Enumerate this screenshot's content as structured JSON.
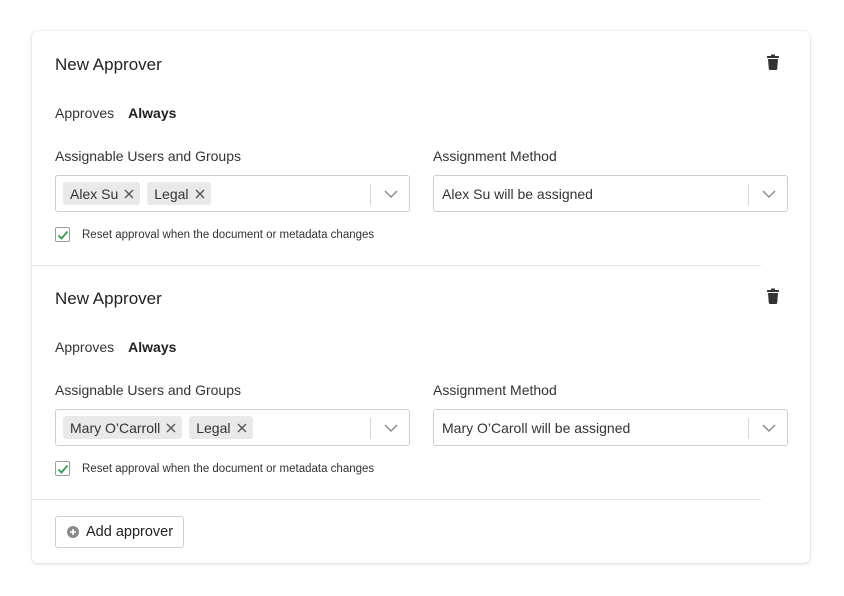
{
  "approvers": [
    {
      "title": "New Approver",
      "approves_label": "Approves",
      "approves_value": "Always",
      "users_label": "Assignable Users and Groups",
      "chips": [
        "Alex Su",
        "Legal"
      ],
      "method_label": "Assignment Method",
      "method_value": "Alex Su will be assigned",
      "reset_label": "Reset approval when the document or metadata changes",
      "reset_checked": true
    },
    {
      "title": "New Approver",
      "approves_label": "Approves",
      "approves_value": "Always",
      "users_label": "Assignable Users and Groups",
      "chips": [
        "Mary O’Carroll",
        "Legal"
      ],
      "method_label": "Assignment Method",
      "method_value": "Mary O’Caroll will be assigned",
      "reset_label": "Reset approval when the document or metadata changes",
      "reset_checked": true
    }
  ],
  "add_button": {
    "label": "Add approver",
    "icon": "plus-circle-icon"
  },
  "icons": {
    "delete": "trash-icon",
    "dropdown": "chevron-down-icon",
    "remove": "close-icon",
    "check": "check-icon"
  },
  "colors": {
    "check": "#2e9e4f",
    "trash": "#333333",
    "chip_bg": "#e9e9ea"
  }
}
